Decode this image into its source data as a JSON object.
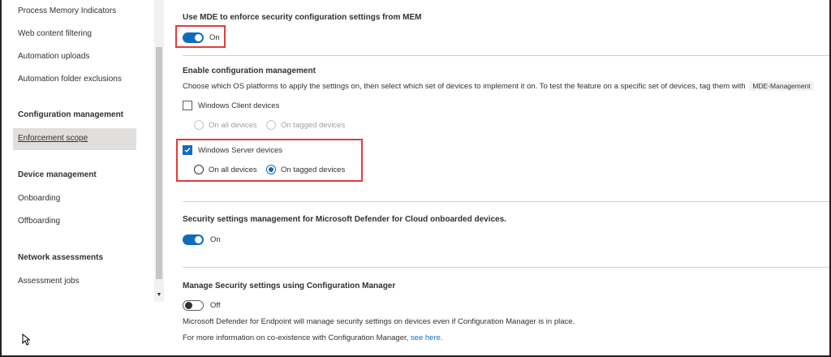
{
  "sidebar": {
    "items": [
      {
        "label": "Process Memory Indicators"
      },
      {
        "label": "Web content filtering"
      },
      {
        "label": "Automation uploads"
      },
      {
        "label": "Automation folder exclusions"
      }
    ],
    "sections": [
      {
        "header": "Configuration management",
        "items": [
          {
            "label": "Enforcement scope",
            "selected": true
          }
        ]
      },
      {
        "header": "Device management",
        "items": [
          {
            "label": "Onboarding"
          },
          {
            "label": "Offboarding"
          }
        ]
      },
      {
        "header": "Network assessments",
        "items": [
          {
            "label": "Assessment jobs"
          }
        ]
      }
    ]
  },
  "main": {
    "mde_enforce": {
      "heading": "Use MDE to enforce security configuration settings from MEM",
      "toggle_label": "On",
      "toggle_on": true
    },
    "config_mgmt": {
      "heading": "Enable configuration management",
      "description": "Choose which OS platforms to apply the settings on, then select which set of devices to implement it on. To test the feature on a specific set of devices, tag them with",
      "tag": "MDE-Management",
      "windows_client": {
        "label": "Windows Client devices",
        "checked": false,
        "options": [
          "On all devices",
          "On tagged devices"
        ]
      },
      "windows_server": {
        "label": "Windows Server devices",
        "checked": true,
        "options": [
          "On all devices",
          "On tagged devices"
        ],
        "selected_option": "On tagged devices"
      }
    },
    "defender_cloud": {
      "heading": "Security settings management for Microsoft Defender for Cloud onboarded devices.",
      "toggle_label": "On",
      "toggle_on": true
    },
    "config_manager": {
      "heading": "Manage Security settings using Configuration Manager",
      "toggle_label": "Off",
      "toggle_on": false,
      "note": "Microsoft Defender for Endpoint will manage security settings on devices even if Configuration Manager is in place.",
      "info_prefix": "For more information on co-existence with Configuration Manager,",
      "info_link": "see here",
      "info_suffix": "."
    }
  },
  "colors": {
    "accent": "#0f6cbd",
    "highlight": "#e03c3c",
    "selected_nav": "#e1dfdd"
  }
}
